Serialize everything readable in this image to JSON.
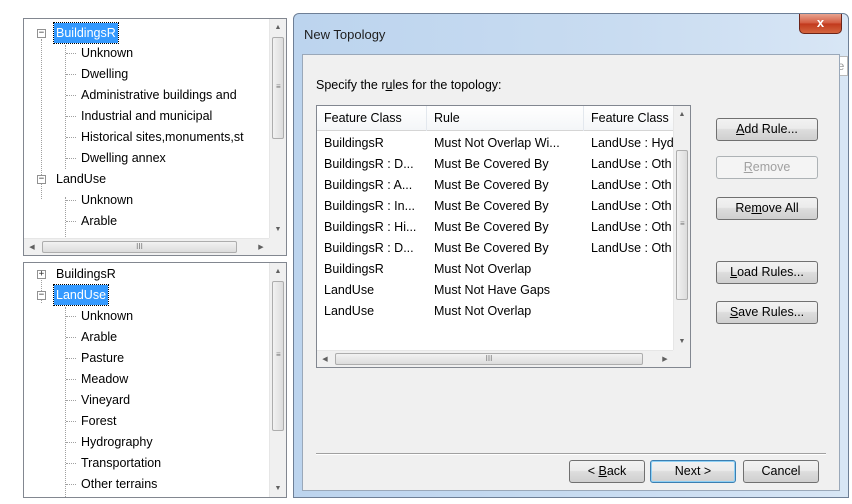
{
  "top_tree": {
    "items": [
      {
        "label": "BuildingsR",
        "expander": "−",
        "selected": true
      },
      {
        "label": "Unknown"
      },
      {
        "label": "Dwelling"
      },
      {
        "label": "Administrative buildings and"
      },
      {
        "label": "Industrial and municipal"
      },
      {
        "label": "Historical sites,monuments,st"
      },
      {
        "label": "Dwelling annex"
      },
      {
        "label": "LandUse",
        "expander": "−"
      },
      {
        "label": "Unknown"
      },
      {
        "label": "Arable"
      }
    ],
    "hscroll_grip": "III"
  },
  "bottom_tree": {
    "items": [
      {
        "label": "BuildingsR",
        "expander": "+"
      },
      {
        "label": "LandUse",
        "expander": "−",
        "selected": true
      },
      {
        "label": "Unknown"
      },
      {
        "label": "Arable"
      },
      {
        "label": "Pasture"
      },
      {
        "label": "Meadow"
      },
      {
        "label": "Vineyard"
      },
      {
        "label": "Forest"
      },
      {
        "label": "Hydrography"
      },
      {
        "label": "Transportation"
      },
      {
        "label": "Other terrains"
      }
    ]
  },
  "dialog": {
    "title": "New Topology",
    "close_symbol": "x",
    "close_tooltip": "Close",
    "instruction_pre": "Specify the r",
    "instruction_ul": "u",
    "instruction_post": "les for the topology:",
    "table": {
      "columns": [
        "Feature Class",
        "Rule",
        "Feature Class"
      ],
      "rows": [
        [
          "BuildingsR",
          "Must Not Overlap Wi...",
          "LandUse : Hyd"
        ],
        [
          "BuildingsR : D...",
          "Must Be Covered By",
          "LandUse : Oth"
        ],
        [
          "BuildingsR : A...",
          "Must Be Covered By",
          "LandUse : Oth"
        ],
        [
          "BuildingsR : In...",
          "Must Be Covered By",
          "LandUse : Oth"
        ],
        [
          "BuildingsR : Hi...",
          "Must Be Covered By",
          "LandUse : Oth"
        ],
        [
          "BuildingsR : D...",
          "Must Be Covered By",
          "LandUse : Oth"
        ],
        [
          "BuildingsR",
          "Must Not Overlap",
          ""
        ],
        [
          "LandUse",
          "Must Not Have Gaps",
          ""
        ],
        [
          "LandUse",
          "Must Not Overlap",
          ""
        ]
      ],
      "hscroll_grip": "III"
    },
    "buttons": {
      "add_rule": {
        "ul": "A",
        "rest": "dd Rule..."
      },
      "remove": {
        "ul": "R",
        "rest": "emove"
      },
      "remove_all": {
        "pre": "Re",
        "ul": "m",
        "rest": "ove All"
      },
      "load_rules": {
        "ul": "L",
        "rest": "oad Rules..."
      },
      "save_rules": {
        "ul": "S",
        "rest": "ave Rules..."
      },
      "back": {
        "pre": "< ",
        "ul": "B",
        "rest": "ack"
      },
      "next": "Next >",
      "cancel": "Cancel"
    }
  }
}
